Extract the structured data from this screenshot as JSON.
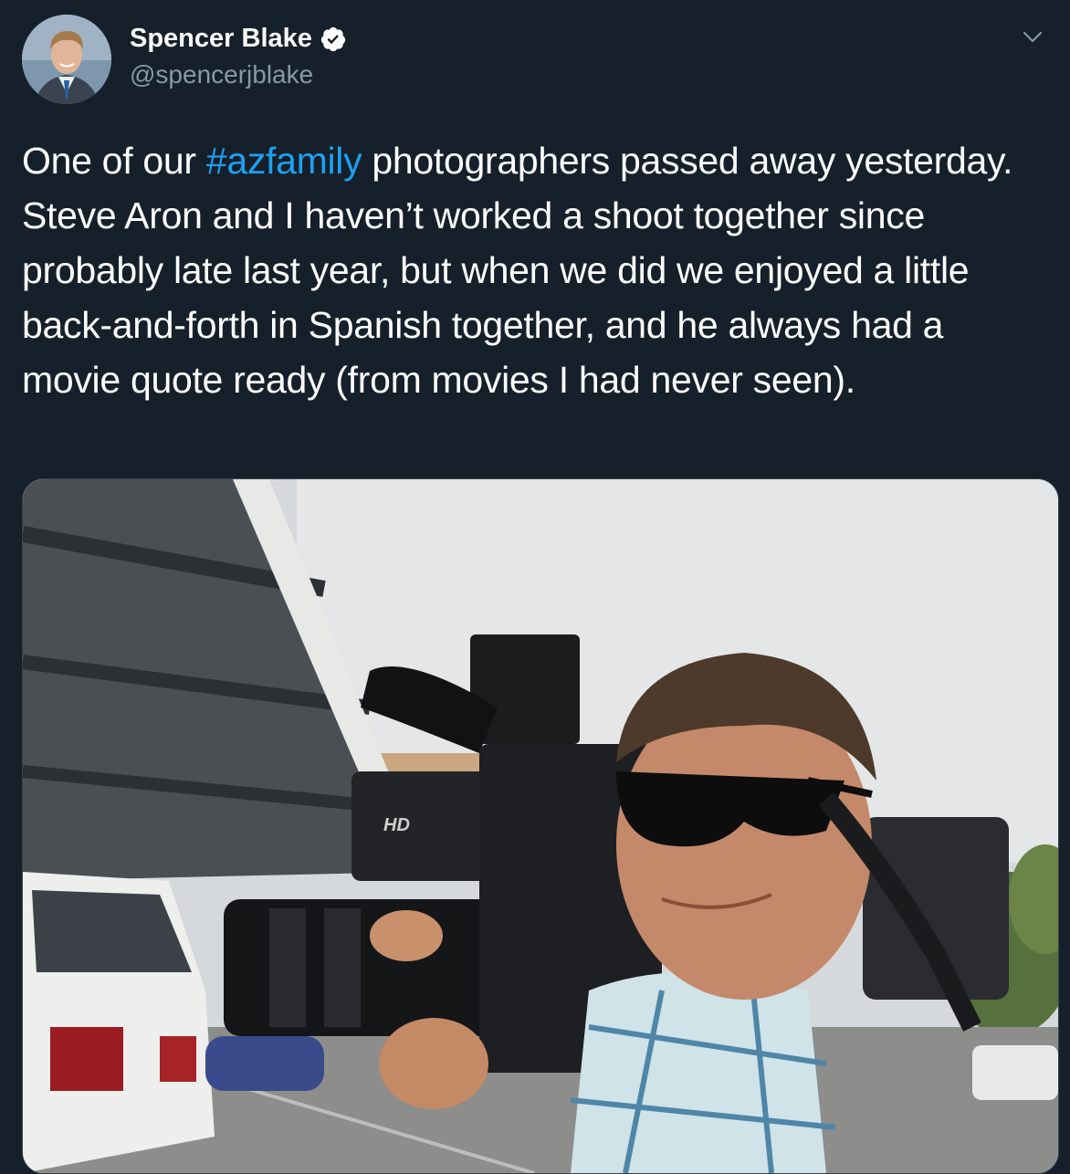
{
  "author": {
    "name": "Spencer Blake",
    "handle": "@spencerjblake",
    "verified": true,
    "avatar_icon": "profile-photo"
  },
  "tweet": {
    "text_before": "One of our ",
    "hashtag": "#azfamily",
    "text_after": " photographers passed away yesterday. Steve Aron and I haven’t worked a shoot together since probably late last year, but when we did we enjoyed a little back-and-forth in Spanish together, and he always had a movie quote ready (from movies I had never seen)."
  },
  "media": {
    "camera_label": "HD"
  },
  "colors": {
    "background": "#15202b",
    "text": "#ffffff",
    "secondary_text": "#8899a6",
    "link": "#1da1f2",
    "verified_badge": "#ffffff"
  },
  "icons": {
    "verified": "verified-badge-icon",
    "more": "chevron-down-icon"
  }
}
